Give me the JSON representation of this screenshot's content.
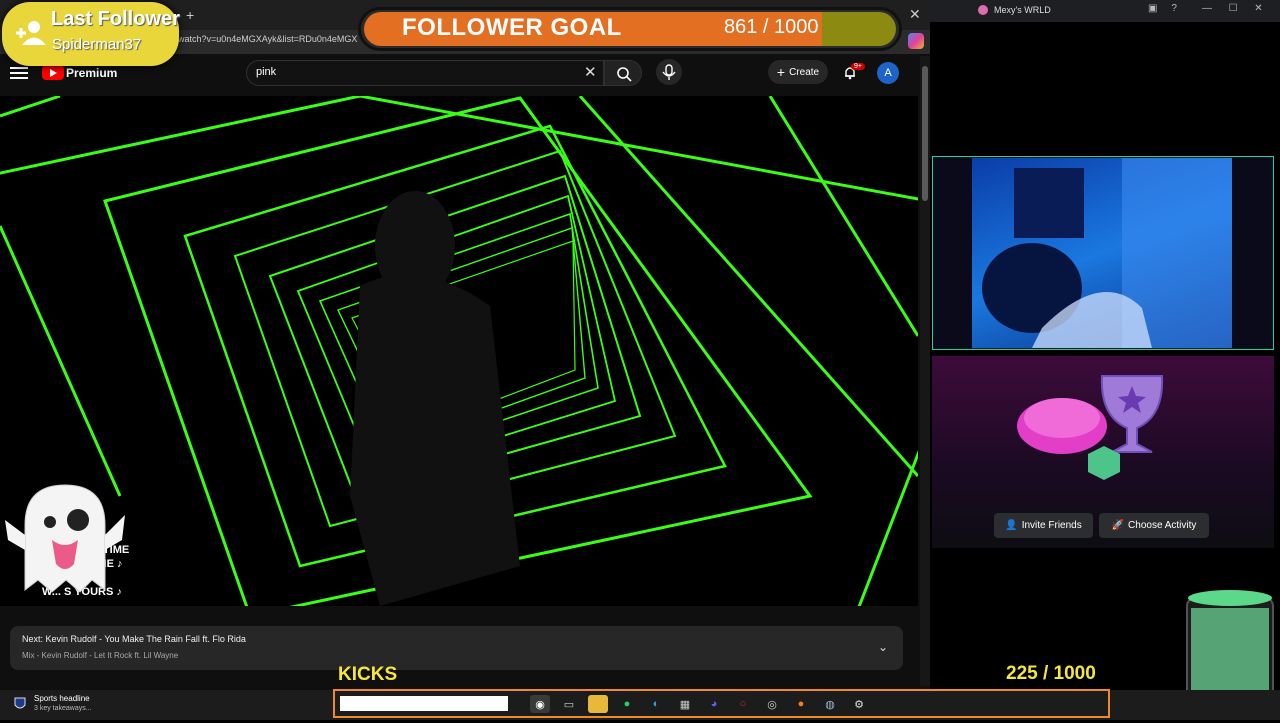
{
  "browser": {
    "url": "watch?v=u0n4eMGXAyk&list=RDu0n4eMGX",
    "new_tab_icon": "plus-icon",
    "close_icon": "close-icon"
  },
  "youtube": {
    "brand": "Premium",
    "search_value": "pink",
    "create_label": "Create",
    "notification_badge": "9+",
    "avatar_letter": "A"
  },
  "video": {
    "lyrics": [
      "AKE YOUR TIME",
      "TAND IN LINE ♪",
      "LL GET",
      "W... S YOURS ♪"
    ]
  },
  "upnext": {
    "title": "Next: Kevin Rudolf - You Make The Rain Fall ft. Flo Rida",
    "subtitle": "Mix - Kevin Rudolf - Let It Rock ft. Lil Wayne"
  },
  "overlay": {
    "last_follower_title": "Last Follower",
    "last_follower_name": "Spiderman37",
    "goal_label": "FOLLOWER GOAL",
    "goal_count": "861  /  1000",
    "goal_progress": 0.861,
    "kicks_label": "KICKS",
    "kicks_count": "225  / 1000"
  },
  "discord": {
    "window_title": "Mexy's WRLD",
    "invite_label": "Invite Friends",
    "activity_label": "Choose Activity"
  },
  "taskbar": {
    "news_title": "Sports headline",
    "news_subtitle": "3 key takeaways..."
  },
  "colors": {
    "accent_orange": "#e36f23",
    "goal_rest": "#8c8a10",
    "follower_yellow": "#e8d63a",
    "kicks_yellow": "#f5e63c",
    "neon_green": "#39ff14"
  }
}
